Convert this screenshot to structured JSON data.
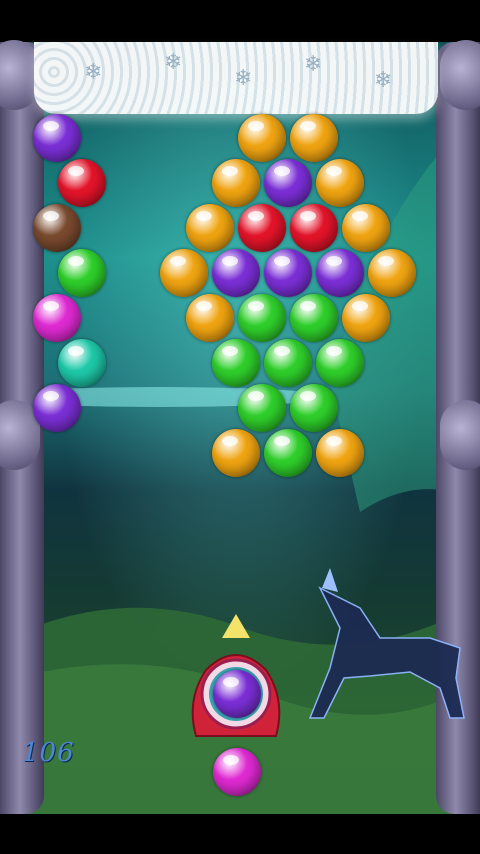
{
  "game": {
    "score": "106",
    "colors": {
      "purple": "#7b2fd6",
      "red": "#e4142a",
      "brown": "#7a4a2e",
      "green": "#2fcf2b",
      "magenta": "#e02ad3",
      "teal": "#1ec9a9",
      "orange": "#f0a411"
    },
    "side_column": [
      "purple",
      "red",
      "brown",
      "green",
      "magenta",
      "teal",
      "purple"
    ],
    "cluster_rows": [
      [
        "orange",
        "orange"
      ],
      [
        "orange",
        "purple",
        "orange"
      ],
      [
        "orange",
        "red",
        "red",
        "orange"
      ],
      [
        "orange",
        "purple",
        "purple",
        "purple",
        "orange"
      ],
      [
        "orange",
        "green",
        "green",
        "orange"
      ],
      [
        "green",
        "green",
        "green"
      ],
      [
        "green",
        "green"
      ],
      [
        "orange",
        "green",
        "orange"
      ]
    ],
    "loaded_bubble": "purple",
    "next_bubble": "magenta",
    "aim_icon": "aim-arrow-icon"
  }
}
